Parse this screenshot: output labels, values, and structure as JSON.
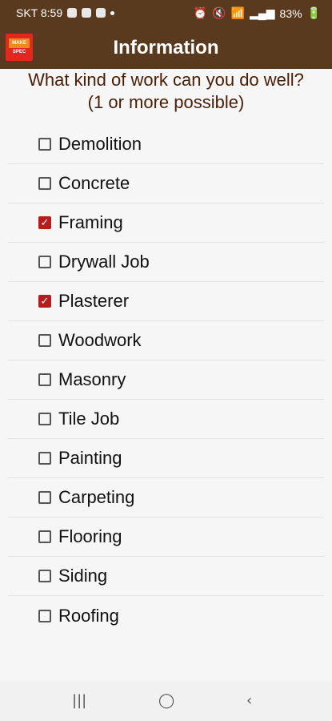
{
  "status": {
    "carrier_time": "SKT 8:59",
    "battery": "83%"
  },
  "header": {
    "title": "Information",
    "logo_top": "MAKE",
    "logo_bottom": "SPEC"
  },
  "question": {
    "line1": "What kind of work can you do well?",
    "line2": "(1 or more possible)"
  },
  "options": [
    {
      "label": "Demolition",
      "checked": false
    },
    {
      "label": "Concrete",
      "checked": false
    },
    {
      "label": "Framing",
      "checked": true
    },
    {
      "label": "Drywall Job",
      "checked": false
    },
    {
      "label": "Plasterer",
      "checked": true
    },
    {
      "label": "Woodwork",
      "checked": false
    },
    {
      "label": "Masonry",
      "checked": false
    },
    {
      "label": "Tile Job",
      "checked": false
    },
    {
      "label": "Painting",
      "checked": false
    },
    {
      "label": "Carpeting",
      "checked": false
    },
    {
      "label": "Flooring",
      "checked": false
    },
    {
      "label": "Siding",
      "checked": false
    },
    {
      "label": "Roofing",
      "checked": false
    }
  ],
  "colors": {
    "appbar": "#5a3a1f",
    "accent": "#b71c1c",
    "question_text": "#4a1d05"
  },
  "navigation": {
    "recents_icon": "recents-icon",
    "home_icon": "home-icon",
    "back_icon": "back-icon"
  }
}
